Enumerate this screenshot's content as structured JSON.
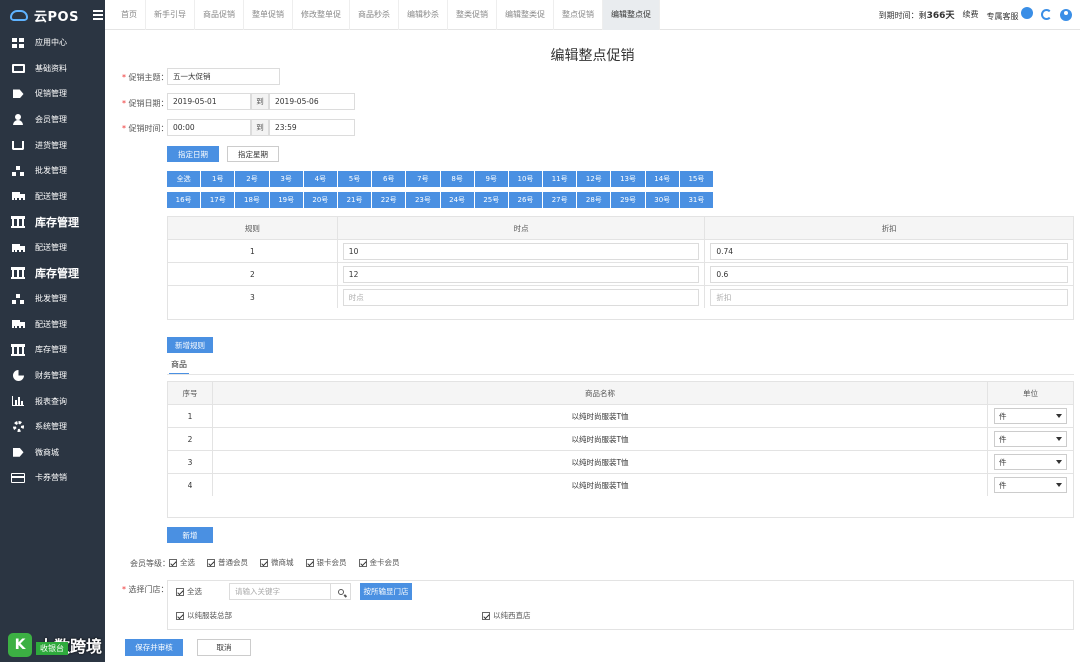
{
  "app": {
    "name": "云POS"
  },
  "sidebar": {
    "items": [
      {
        "label": "应用中心",
        "icon": "grid-icon"
      },
      {
        "label": "基础资料",
        "icon": "monitor-icon"
      },
      {
        "label": "促销管理",
        "icon": "tag-icon"
      },
      {
        "label": "会员管理",
        "icon": "user-icon"
      },
      {
        "label": "进货管理",
        "icon": "cart-icon"
      },
      {
        "label": "批发管理",
        "icon": "sitemap-icon"
      },
      {
        "label": "配送管理",
        "icon": "truck-icon"
      },
      {
        "label": "库存管理",
        "icon": "bank-icon"
      },
      {
        "label": "配送管理",
        "icon": "truck-icon"
      },
      {
        "label": "库存管理",
        "icon": "bank-icon"
      },
      {
        "label": "批发管理",
        "icon": "sitemap-icon"
      },
      {
        "label": "配送管理",
        "icon": "truck-icon"
      },
      {
        "label": "库存管理",
        "icon": "bank-icon"
      },
      {
        "label": "财务管理",
        "icon": "pie-chart-icon"
      },
      {
        "label": "报表查询",
        "icon": "bar-chart-icon"
      },
      {
        "label": "系统管理",
        "icon": "gear-icon"
      },
      {
        "label": "微商城",
        "icon": "tag-icon"
      },
      {
        "label": "卡券营销",
        "icon": "card-icon"
      }
    ]
  },
  "watermark": {
    "badge": "K",
    "text": "大数跨境",
    "sub": "收银台"
  },
  "tabs": [
    "首页",
    "新手引导",
    "商品促销",
    "整单促销",
    "修改整单促",
    "商品秒杀",
    "编辑秒杀",
    "整类促销",
    "编辑整类促",
    "整点促销",
    "编辑整点促"
  ],
  "active_tab_index": 10,
  "header": {
    "expire_label": "到期时间：剩",
    "expire_days": "366天",
    "renew": "续费",
    "exclusive": "专属客服"
  },
  "page": {
    "title": "编辑整点促销"
  },
  "form": {
    "theme_label": "促销主题：",
    "theme_value": "五一大促销",
    "date_label": "促销日期：",
    "date_start": "2019-05-01",
    "date_to": "到",
    "date_end": "2019-05-06",
    "time_label": "促销时间：",
    "time_start": "00:00",
    "time_to": "到",
    "time_end": "23:59",
    "mode_btn_date": "指定日期",
    "mode_btn_week": "指定星期"
  },
  "days_row1": [
    "全选",
    "1号",
    "2号",
    "3号",
    "4号",
    "5号",
    "6号",
    "7号",
    "8号",
    "9号",
    "10号",
    "11号",
    "12号",
    "13号",
    "14号",
    "15号"
  ],
  "days_row2": [
    "16号",
    "17号",
    "18号",
    "19号",
    "20号",
    "21号",
    "22号",
    "23号",
    "24号",
    "25号",
    "26号",
    "27号",
    "28号",
    "29号",
    "30号",
    "31号"
  ],
  "rules_table": {
    "headers": [
      "规则",
      "时点",
      "折扣"
    ],
    "rows": [
      {
        "no": "1",
        "hour": "10",
        "discount": "0.74"
      },
      {
        "no": "2",
        "hour": "12",
        "discount": "0.6"
      },
      {
        "no": "3",
        "hour_placeholder": "时点",
        "discount_placeholder": "折扣"
      }
    ],
    "add_btn": "新增规则"
  },
  "product_section": {
    "tab": "商品"
  },
  "product_table": {
    "headers": [
      "序号",
      "商品名称",
      "单位"
    ],
    "rows": [
      {
        "no": "1",
        "name": "以纯时尚服装T恤",
        "unit": "件"
      },
      {
        "no": "2",
        "name": "以纯时尚服装T恤",
        "unit": "件"
      },
      {
        "no": "3",
        "name": "以纯时尚服装T恤",
        "unit": "件"
      },
      {
        "no": "4",
        "name": "以纯时尚服装T恤",
        "unit": "件"
      }
    ],
    "add_btn": "新增"
  },
  "member": {
    "label": "会员等级：",
    "options": [
      "全选",
      "普通会员",
      "微商城",
      "银卡会员",
      "金卡会员"
    ]
  },
  "stores": {
    "label": "选择门店：",
    "select_all": "全选",
    "search_placeholder": "请输入关键字",
    "filter_btn": "按所输显门店",
    "items": [
      "以纯服装总部",
      "以纯西直店"
    ]
  },
  "footer": {
    "save": "保存并审核",
    "cancel": "取消"
  }
}
